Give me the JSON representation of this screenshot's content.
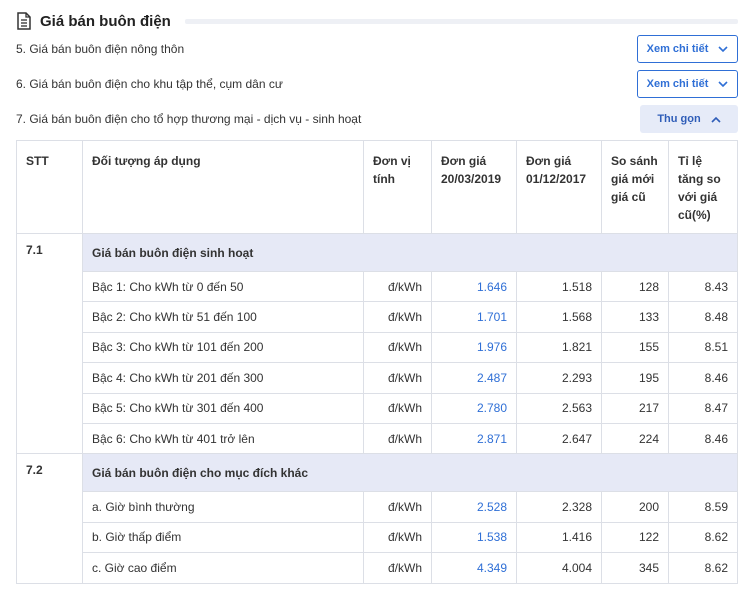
{
  "header": {
    "title": "Giá bán buôn điện"
  },
  "items": [
    {
      "label": "5. Giá bán buôn điện nông thôn",
      "button": "Xem chi tiết"
    },
    {
      "label": "6. Giá bán buôn điện cho khu tập thể, cụm dân cư",
      "button": "Xem chi tiết"
    },
    {
      "label": "7. Giá bán buôn điện cho tổ hợp thương mại - dịch vụ - sinh hoạt",
      "button": "Thu gọn"
    }
  ],
  "table": {
    "headers": [
      "STT",
      "Đối tượng áp dụng",
      "Đơn vị tính",
      "Đơn giá 20/03/2019",
      "Đơn giá 01/12/2017",
      "So sánh giá mới giá cũ",
      "Tỉ lệ tăng so với giá cũ(%)"
    ],
    "groups": [
      {
        "stt": "7.1",
        "title": "Giá bán buôn điện sinh hoạt",
        "rows": [
          {
            "name": "Bậc 1: Cho kWh từ 0 đến 50",
            "unit": "đ/kWh",
            "new": "1.646",
            "old": "1.518",
            "diff": "128",
            "pct": "8.43"
          },
          {
            "name": "Bậc 2: Cho kWh từ 51 đến 100",
            "unit": "đ/kWh",
            "new": "1.701",
            "old": "1.568",
            "diff": "133",
            "pct": "8.48"
          },
          {
            "name": "Bậc 3: Cho kWh từ 101 đến 200",
            "unit": "đ/kWh",
            "new": "1.976",
            "old": "1.821",
            "diff": "155",
            "pct": "8.51"
          },
          {
            "name": "Bậc 4: Cho kWh từ 201 đến 300",
            "unit": "đ/kWh",
            "new": "2.487",
            "old": "2.293",
            "diff": "195",
            "pct": "8.46"
          },
          {
            "name": "Bậc 5: Cho kWh từ 301 đến 400",
            "unit": "đ/kWh",
            "new": "2.780",
            "old": "2.563",
            "diff": "217",
            "pct": "8.47"
          },
          {
            "name": "Bậc 6: Cho kWh từ 401 trở lên",
            "unit": "đ/kWh",
            "new": "2.871",
            "old": "2.647",
            "diff": "224",
            "pct": "8.46"
          }
        ]
      },
      {
        "stt": "7.2",
        "title": "Giá bán buôn điện cho mục đích khác",
        "rows": [
          {
            "name": "a. Giờ bình thường",
            "unit": "đ/kWh",
            "new": "2.528",
            "old": "2.328",
            "diff": "200",
            "pct": "8.59"
          },
          {
            "name": "b. Giờ thấp điểm",
            "unit": "đ/kWh",
            "new": "1.538",
            "old": "1.416",
            "diff": "122",
            "pct": "8.62"
          },
          {
            "name": "c. Giờ cao điểm",
            "unit": "đ/kWh",
            "new": "4.349",
            "old": "4.004",
            "diff": "345",
            "pct": "8.62"
          }
        ]
      }
    ]
  },
  "colors": {
    "accent": "#2f6fd6",
    "group_bg": "#e6e9f6",
    "border": "#dcdfe6"
  },
  "icons": {
    "header": "document-icon",
    "expand": "chevron-down-icon",
    "collapse": "chevron-up-icon"
  }
}
